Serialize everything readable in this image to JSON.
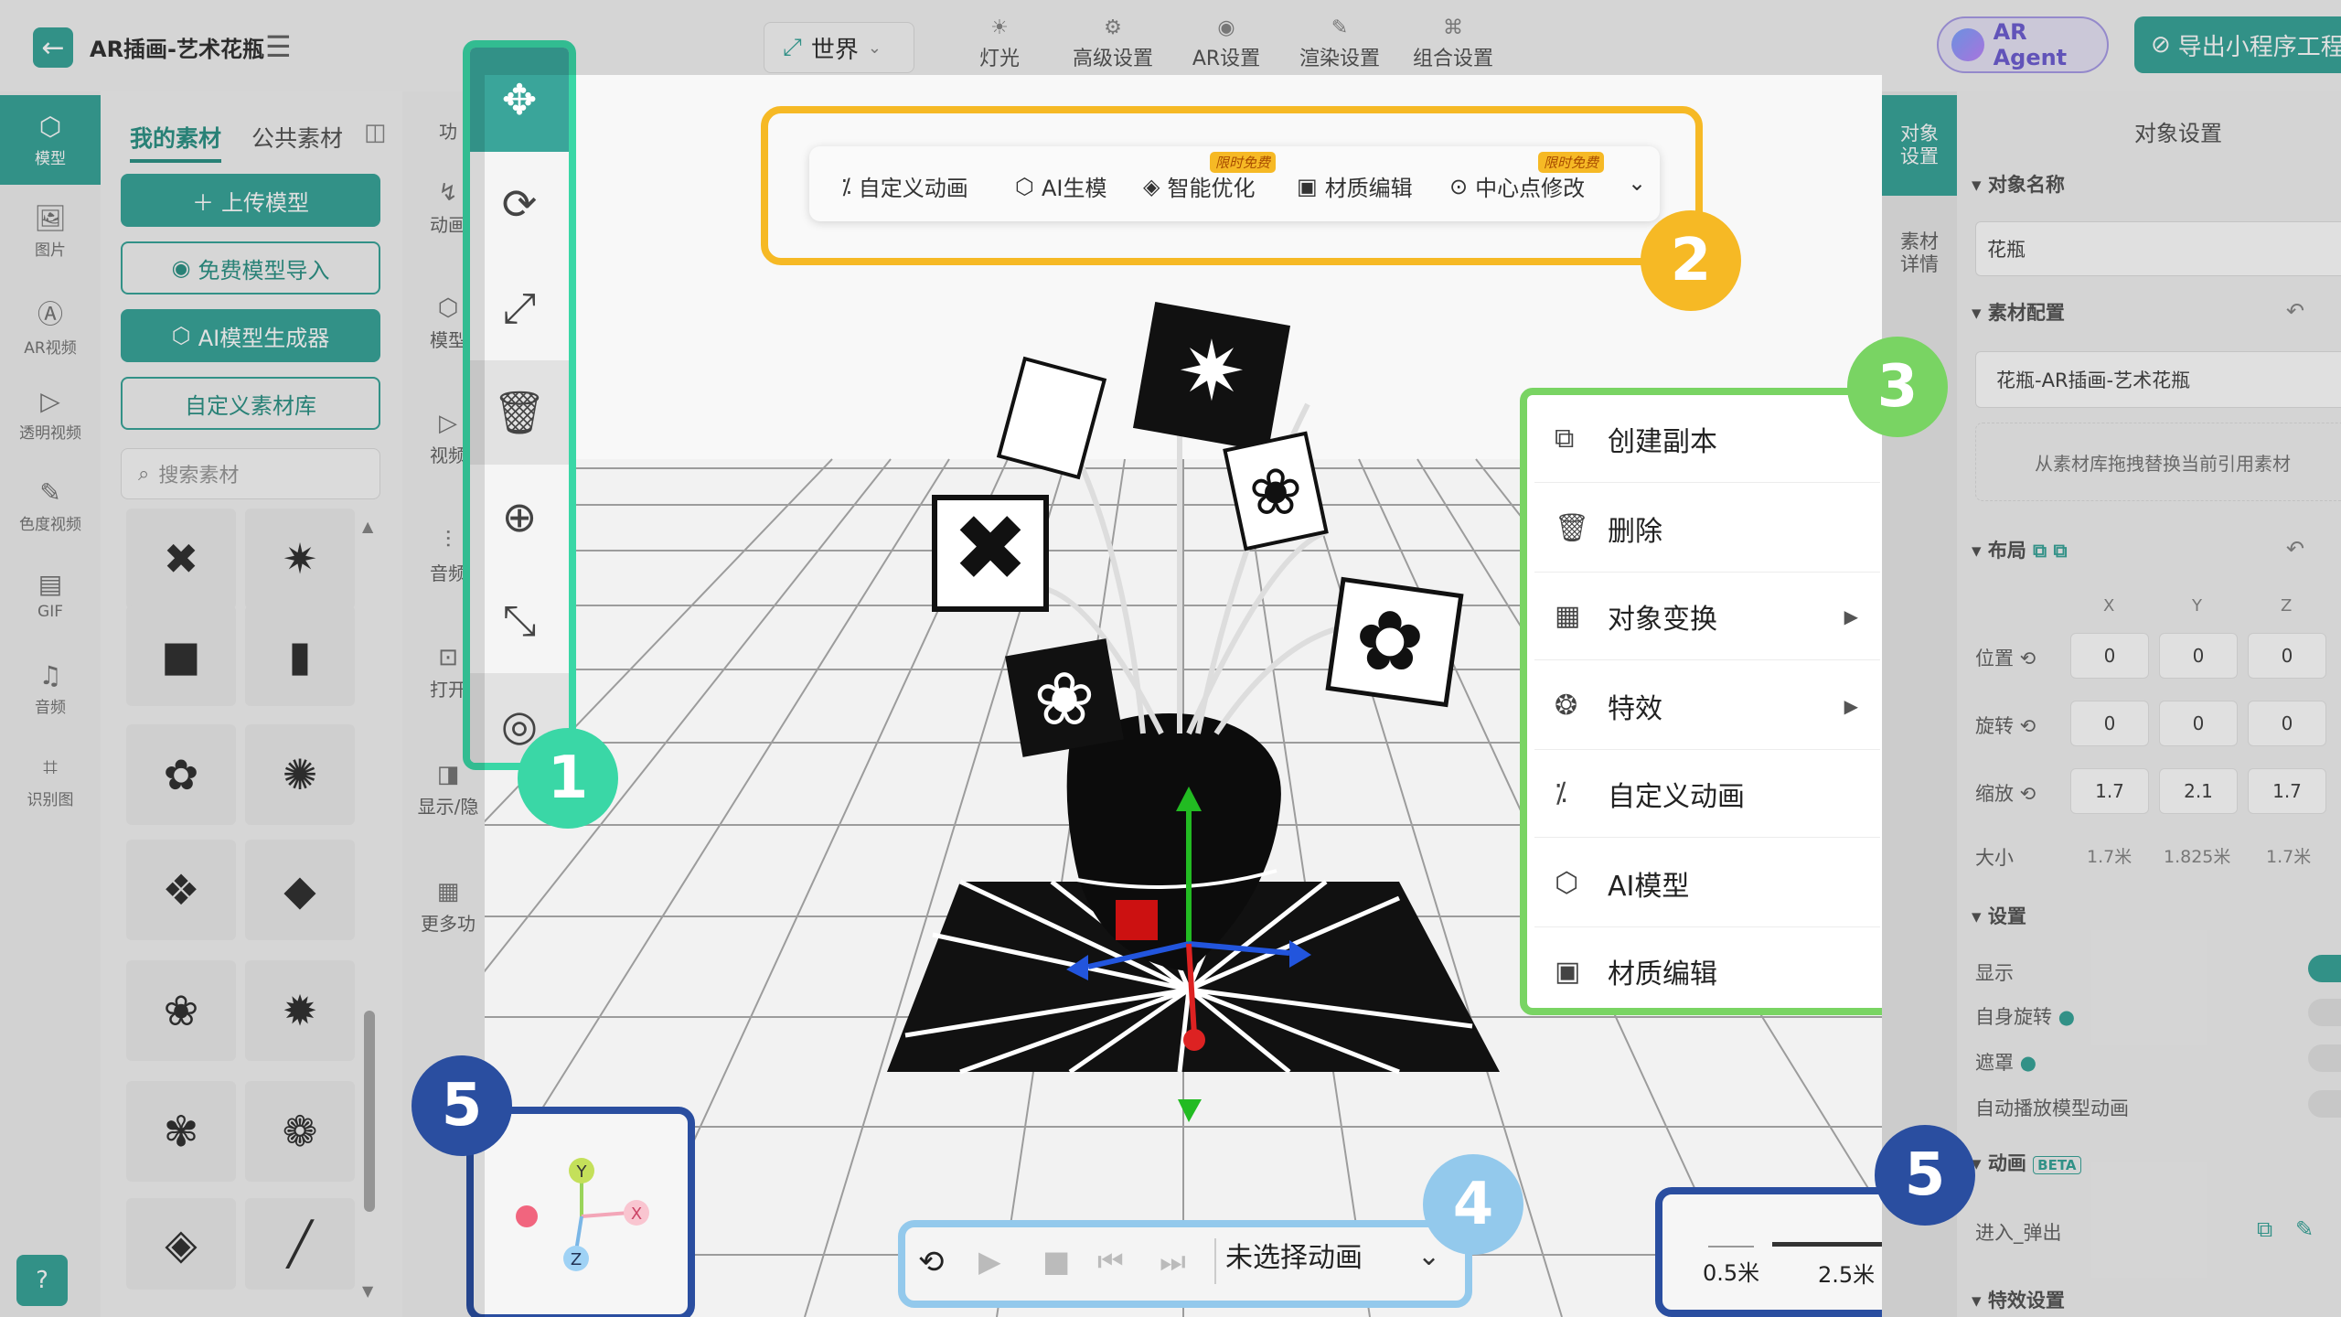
{
  "header": {
    "title": "AR插画-艺术花瓶",
    "world_select": "世界",
    "nav": [
      {
        "label": "灯光",
        "icon": "sun-icon"
      },
      {
        "label": "高级设置",
        "icon": "gear-icon"
      },
      {
        "label": "AR设置",
        "icon": "ar-icon"
      },
      {
        "label": "渲染设置",
        "icon": "paint-icon"
      },
      {
        "label": "组合设置",
        "icon": "hierarchy-icon"
      }
    ],
    "ar_agent": "AR Agent",
    "export": "导出小程序工程"
  },
  "leftbar": [
    {
      "label": "模型",
      "icon": "cube-icon"
    },
    {
      "label": "图片",
      "icon": "image-icon"
    },
    {
      "label": "AR视频",
      "icon": "ar-video-icon"
    },
    {
      "label": "透明视频",
      "icon": "video-icon"
    },
    {
      "label": "色度视频",
      "icon": "chroma-icon"
    },
    {
      "label": "GIF",
      "icon": "gif-icon"
    },
    {
      "label": "音频",
      "icon": "music-icon"
    },
    {
      "label": "识别图",
      "icon": "scan-icon"
    }
  ],
  "assets": {
    "tabs": [
      "我的素材",
      "公共素材"
    ],
    "upload": "上传模型",
    "free_import": "免费模型导入",
    "ai_gen": "AI模型生成器",
    "custom_lib": "自定义素材库",
    "search_placeholder": "搜索素材"
  },
  "funcs": [
    "功",
    "动画",
    "模型",
    "视频",
    "音频",
    "打开",
    "显示/隐",
    "更多功"
  ],
  "toolbar": [
    "move-icon",
    "rotate-icon",
    "scale-icon",
    "delete-icon",
    "target-icon",
    "shrink-icon",
    "eye-icon"
  ],
  "actionbar": [
    {
      "label": "自定义动画",
      "icon": "anim-icon",
      "badge": ""
    },
    {
      "label": "AI生模",
      "icon": "ai-cube-icon",
      "badge": ""
    },
    {
      "label": "智能优化",
      "icon": "zip-icon",
      "badge": "限时免费"
    },
    {
      "label": "材质编辑",
      "icon": "image-icon",
      "badge": ""
    },
    {
      "label": "中心点修改",
      "icon": "center-icon",
      "badge": "限时免费"
    }
  ],
  "context_menu": [
    {
      "label": "创建副本",
      "icon": "copy-icon",
      "arrow": false
    },
    {
      "label": "删除",
      "icon": "trash-icon",
      "arrow": false
    },
    {
      "label": "对象变换",
      "icon": "grid-icon",
      "arrow": true
    },
    {
      "label": "特效",
      "icon": "effects-icon",
      "arrow": true
    },
    {
      "label": "自定义动画",
      "icon": "anim-icon",
      "arrow": false
    },
    {
      "label": "AI模型",
      "icon": "ai-cube-icon",
      "arrow": false
    },
    {
      "label": "材质编辑",
      "icon": "image-icon",
      "arrow": false
    }
  ],
  "markers": [
    "1",
    "2",
    "3",
    "4",
    "5",
    "5"
  ],
  "animation": {
    "selected": "未选择动画"
  },
  "scale": [
    "0.5米",
    "2.5米"
  ],
  "axes": [
    "Y",
    "X",
    "Z"
  ],
  "right": {
    "tabs": [
      "对象设置",
      "素材详情"
    ],
    "title": "对象设置",
    "object_name_label": "对象名称",
    "object_name": "花瓶",
    "material_label": "素材配置",
    "material_value": "花瓶-AR插画-艺术花瓶",
    "material_hint": "从素材库拖拽替换当前引用素材",
    "layout_label": "布局",
    "axes": [
      "X",
      "Y",
      "Z"
    ],
    "rows": [
      {
        "label": "位置",
        "v": [
          "0",
          "0",
          "0"
        ]
      },
      {
        "label": "旋转",
        "v": [
          "0",
          "0",
          "0"
        ]
      },
      {
        "label": "缩放",
        "v": [
          "1.7",
          "2.1",
          "1.7"
        ]
      }
    ],
    "size_label": "大小",
    "size": [
      "1.7米",
      "1.825米",
      "1.7米"
    ],
    "settings_label": "设置",
    "settings": [
      "显示",
      "自身旋转",
      "遮罩",
      "自动播放模型动画"
    ],
    "anim_label": "动画",
    "beta": "BETA",
    "anim_item": "进入_弹出",
    "effects_label": "特效设置"
  },
  "colors": {
    "accent": "#3aa59a",
    "m1": "#3ad7a6",
    "m2": "#f6b925",
    "m3": "#79d463",
    "m4": "#93c9ec",
    "m5": "#2a4ea0"
  }
}
